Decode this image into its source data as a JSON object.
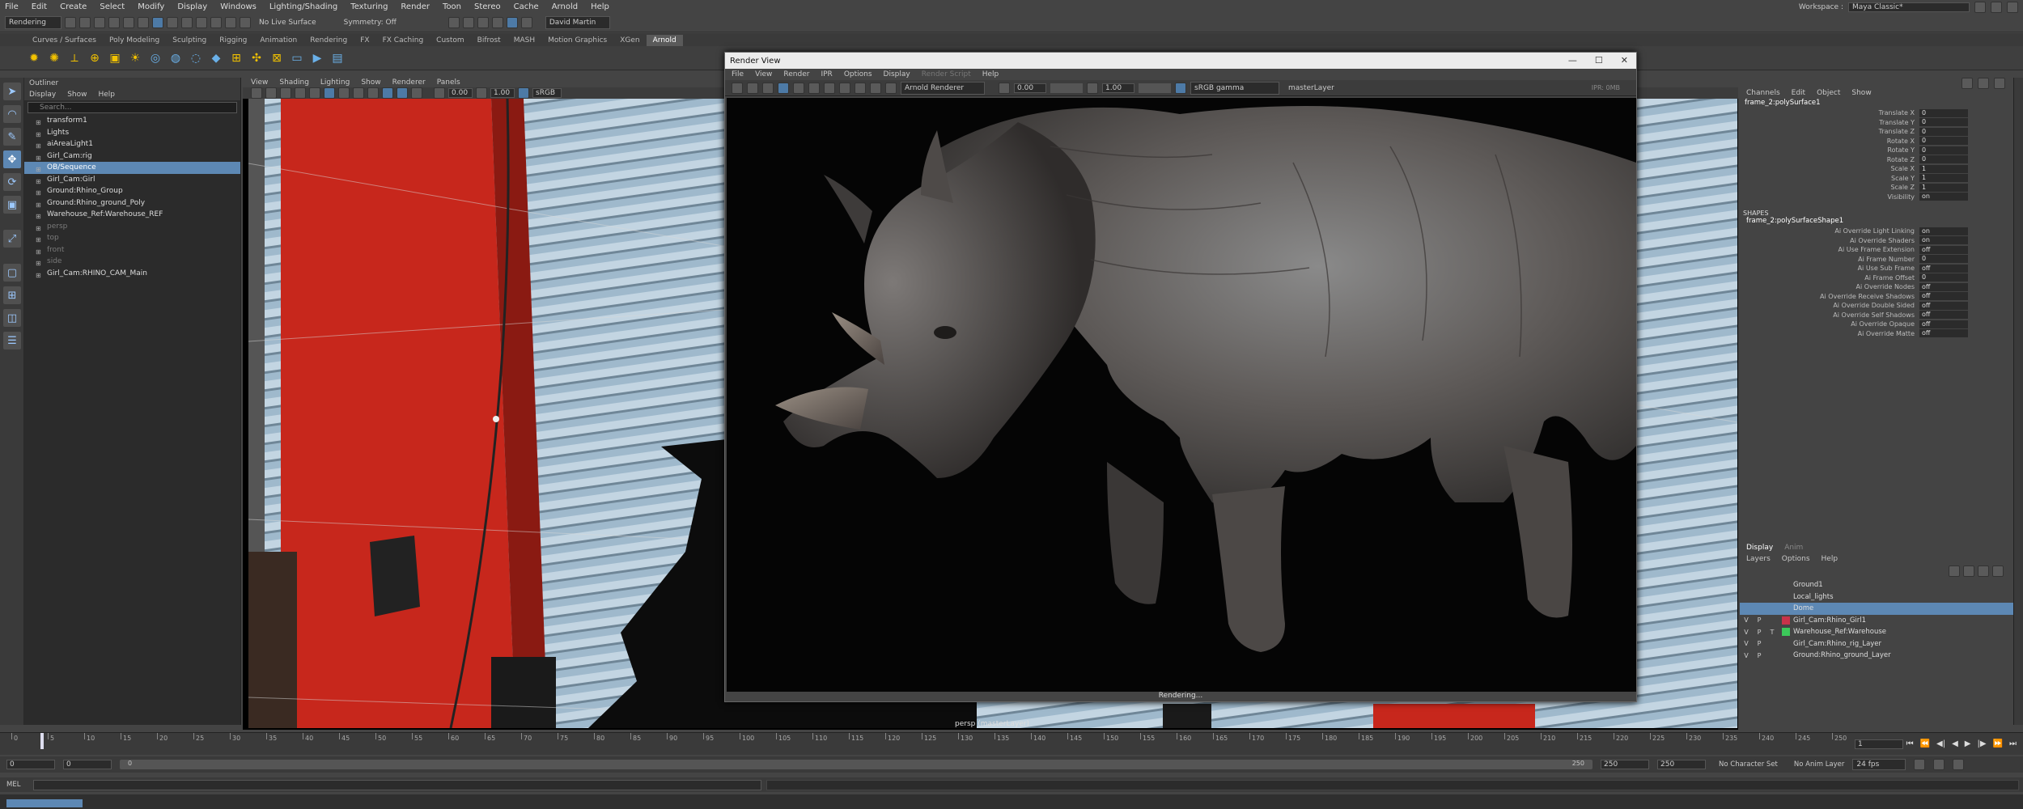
{
  "menubar": {
    "items": [
      "File",
      "Edit",
      "Create",
      "Select",
      "Modify",
      "Display",
      "Windows",
      "Lighting/Shading",
      "Texturing",
      "Render",
      "Toon",
      "Stereo",
      "Cache",
      "Arnold",
      "Help"
    ],
    "workspace_label": "Workspace :",
    "workspace_value": "Maya Classic*"
  },
  "statusline": {
    "mode": "Rendering",
    "live_surface": "No Live Surface",
    "symmetry": "Symmetry: Off",
    "user": "David Martin"
  },
  "shelf": {
    "tabs": [
      "Curves / Surfaces",
      "Poly Modeling",
      "Sculpting",
      "Rigging",
      "Animation",
      "Rendering",
      "FX",
      "FX Caching",
      "Custom",
      "Bifrost",
      "MASH",
      "Motion Graphics",
      "XGen",
      "Arnold"
    ],
    "active": "Arnold"
  },
  "outliner": {
    "title": "Outliner",
    "menu": [
      "Display",
      "Show",
      "Help"
    ],
    "search_placeholder": "Search...",
    "items": [
      {
        "label": "transform1",
        "state": "normal"
      },
      {
        "label": "Lights",
        "state": "normal"
      },
      {
        "label": "aiAreaLight1",
        "state": "normal"
      },
      {
        "label": "Girl_Cam:rig",
        "state": "normal"
      },
      {
        "label": "OB/Sequence",
        "state": "selected"
      },
      {
        "label": "Girl_Cam:Girl",
        "state": "normal"
      },
      {
        "label": "Ground:Rhino_Group",
        "state": "normal"
      },
      {
        "label": "Ground:Rhino_ground_Poly",
        "state": "normal"
      },
      {
        "label": "Warehouse_Ref:Warehouse_REF",
        "state": "normal"
      },
      {
        "label": "persp",
        "state": "dim"
      },
      {
        "label": "top",
        "state": "dim"
      },
      {
        "label": "front",
        "state": "dim"
      },
      {
        "label": "side",
        "state": "dim"
      },
      {
        "label": "Girl_Cam:RHINO_CAM_Main",
        "state": "normal"
      }
    ]
  },
  "viewport": {
    "menu": [
      "View",
      "Shading",
      "Lighting",
      "Show",
      "Renderer",
      "Panels"
    ],
    "exposure": "0.00",
    "gamma": "1.00",
    "colorspace": "sRGB g",
    "camera_label": "persp (masterLayer)"
  },
  "render_view": {
    "title": "Render View",
    "menu": [
      "File",
      "View",
      "Render",
      "IPR",
      "Options",
      "Display",
      "Render Script",
      "Help"
    ],
    "renderer": "Arnold Renderer",
    "exposure": "0.00",
    "gamma": "1.00",
    "colorspace": "sRGB gamma",
    "layer": "masterLayer",
    "ipr": "IPR: 0MB",
    "status": "Rendering..."
  },
  "channel_box": {
    "menu": [
      "Channels",
      "Edit",
      "Object",
      "Show"
    ],
    "object": "frame_2:polySurface1",
    "attributes": [
      {
        "name": "Translate X",
        "value": "0"
      },
      {
        "name": "Translate Y",
        "value": "0"
      },
      {
        "name": "Translate Z",
        "value": "0"
      },
      {
        "name": "Rotate X",
        "value": "0"
      },
      {
        "name": "Rotate Y",
        "value": "0"
      },
      {
        "name": "Rotate Z",
        "value": "0"
      },
      {
        "name": "Scale X",
        "value": "1"
      },
      {
        "name": "Scale Y",
        "value": "1"
      },
      {
        "name": "Scale Z",
        "value": "1"
      },
      {
        "name": "Visibility",
        "value": "on"
      }
    ],
    "shapes_header": "SHAPES",
    "shape_name": "frame_2:polySurfaceShape1",
    "shape_attributes": [
      {
        "name": "Ai Override Light Linking",
        "value": "on"
      },
      {
        "name": "Ai Override Shaders",
        "value": "on"
      },
      {
        "name": "Ai Use Frame Extension",
        "value": "off"
      },
      {
        "name": "Ai Frame Number",
        "value": "0"
      },
      {
        "name": "Ai Use Sub Frame",
        "value": "off"
      },
      {
        "name": "Ai Frame Offset",
        "value": "0"
      },
      {
        "name": "Ai Override Nodes",
        "value": "off"
      },
      {
        "name": "Ai Override Receive Shadows",
        "value": "off"
      },
      {
        "name": "Ai Override Double Sided",
        "value": "off"
      },
      {
        "name": "Ai Override Self Shadows",
        "value": "off"
      },
      {
        "name": "Ai Override Opaque",
        "value": "off"
      },
      {
        "name": "Ai Override Matte",
        "value": "off"
      }
    ]
  },
  "layer_editor": {
    "tabs": [
      "Display",
      "Anim"
    ],
    "menu": [
      "Layers",
      "Options",
      "Help"
    ],
    "layers": [
      {
        "v": "",
        "p": "",
        "t": "",
        "color": "",
        "label": "Ground1",
        "selected": false
      },
      {
        "v": "",
        "p": "",
        "t": "",
        "color": "",
        "label": "Local_lights",
        "selected": false
      },
      {
        "v": "",
        "p": "",
        "t": "",
        "color": "",
        "label": "Dome",
        "selected": true
      },
      {
        "v": "V",
        "p": "P",
        "t": "",
        "color": "#c8324a",
        "label": "Girl_Cam:Rhino_Girl1",
        "selected": false
      },
      {
        "v": "V",
        "p": "P",
        "t": "T",
        "color": "#3cc85a",
        "label": "Warehouse_Ref:Warehouse",
        "selected": false
      },
      {
        "v": "V",
        "p": "P",
        "t": "",
        "color": "",
        "label": "Girl_Cam:Rhino_rig_Layer",
        "selected": false
      },
      {
        "v": "V",
        "p": "P",
        "t": "",
        "color": "",
        "label": "Ground:Rhino_ground_Layer",
        "selected": false
      }
    ]
  },
  "timeline": {
    "ticks": [
      "0",
      "5",
      "10",
      "15",
      "20",
      "25",
      "30",
      "35",
      "40",
      "45",
      "50",
      "55",
      "60",
      "65",
      "70",
      "75",
      "80",
      "85",
      "90",
      "95",
      "100",
      "105",
      "110",
      "115",
      "120",
      "125",
      "130",
      "135",
      "140",
      "145",
      "150",
      "155",
      "160",
      "165",
      "170",
      "175",
      "180",
      "185",
      "190",
      "195",
      "200",
      "205",
      "210",
      "215",
      "220",
      "225",
      "230",
      "235",
      "240",
      "245",
      "250"
    ],
    "current_frame": "1"
  },
  "range": {
    "start": "0",
    "inner_start": "0",
    "slider_start": "0",
    "slider_end": "250",
    "end_a": "250",
    "end_b": "250",
    "character_set": "No Character Set",
    "anim_layer": "No Anim Layer",
    "fps": "24 fps"
  },
  "mel": {
    "label": "MEL"
  }
}
